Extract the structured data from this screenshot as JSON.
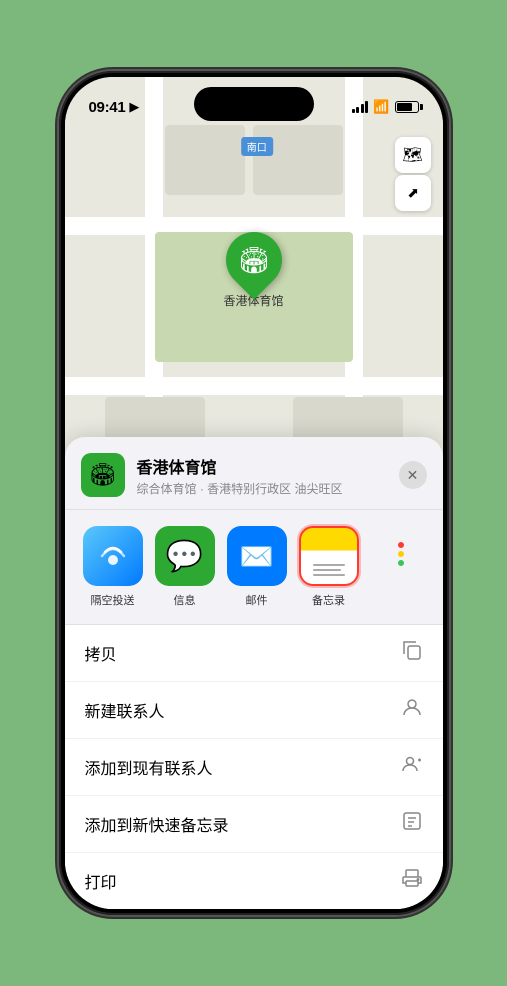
{
  "status": {
    "time": "09:41",
    "location_arrow": "▶"
  },
  "map": {
    "label": "南口",
    "venue_name": "香港体育馆",
    "venue_subtitle": "综合体育馆 · 香港特别行政区 油尖旺区"
  },
  "controls": {
    "map_icon": "🗺",
    "location_icon": "⬆"
  },
  "share_items": [
    {
      "id": "airdrop",
      "label": "隔空投送"
    },
    {
      "id": "message",
      "label": "信息"
    },
    {
      "id": "mail",
      "label": "邮件"
    },
    {
      "id": "notes",
      "label": "备忘录"
    }
  ],
  "actions": [
    {
      "label": "拷贝",
      "icon": "⎘"
    },
    {
      "label": "新建联系人",
      "icon": "👤"
    },
    {
      "label": "添加到现有联系人",
      "icon": "👤"
    },
    {
      "label": "添加到新快速备忘录",
      "icon": "📋"
    },
    {
      "label": "打印",
      "icon": "🖨"
    }
  ],
  "close_btn": "✕",
  "home_indicator": true
}
